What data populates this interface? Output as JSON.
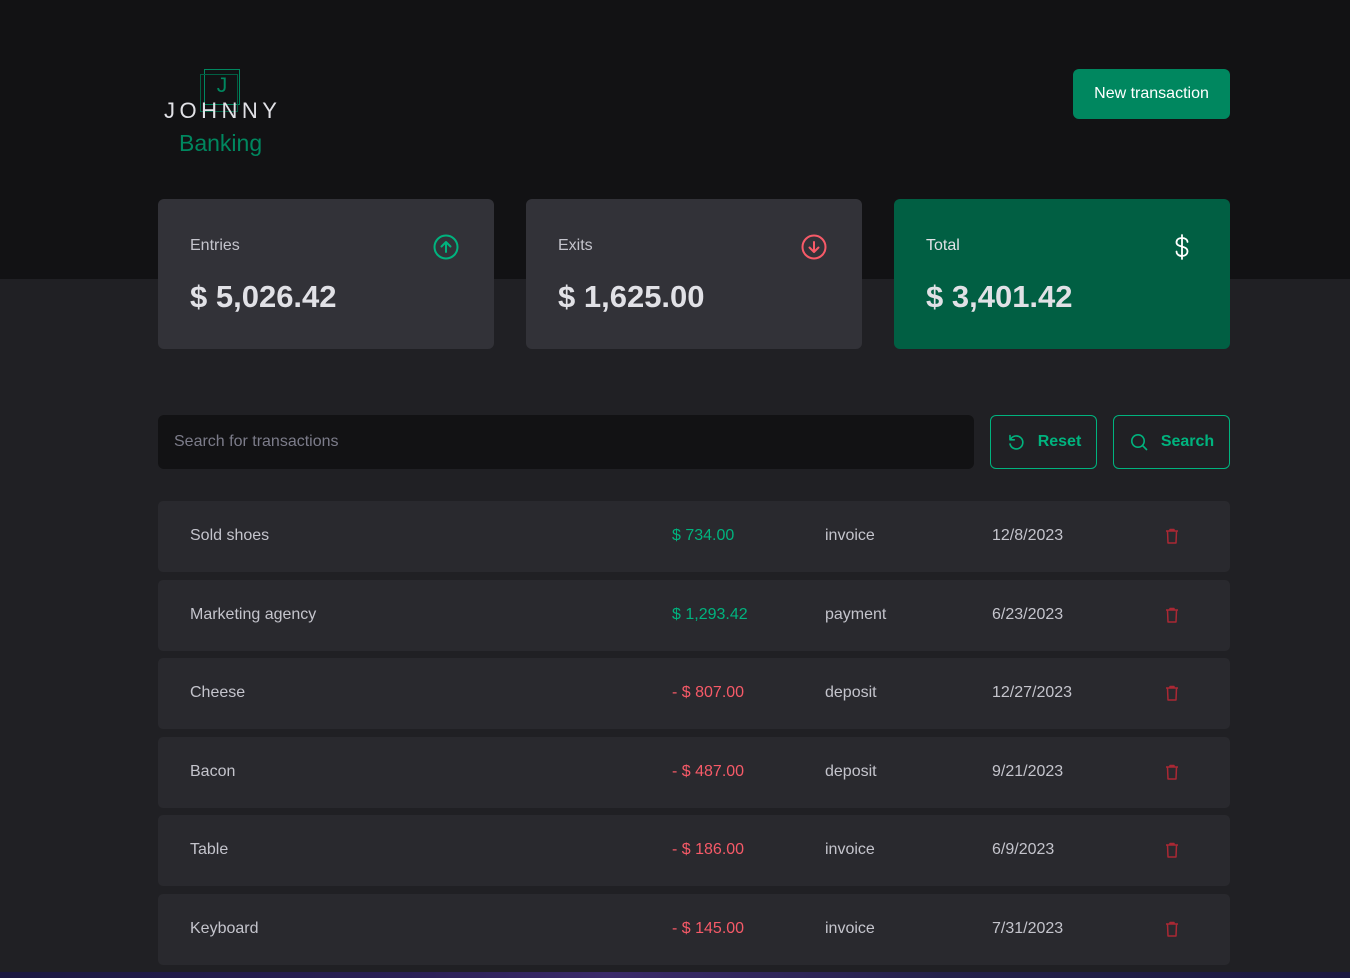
{
  "brand": {
    "letter": "J",
    "name": "JOHNNY",
    "sub": "Banking"
  },
  "header": {
    "new_transaction_label": "New transaction"
  },
  "summary": {
    "entries": {
      "label": "Entries",
      "value": "$ 5,026.42",
      "icon": "arrow-circle-up-icon",
      "color": "#00b37e"
    },
    "exits": {
      "label": "Exits",
      "value": "$ 1,625.00",
      "icon": "arrow-circle-down-icon",
      "color": "#f75a68"
    },
    "total": {
      "label": "Total",
      "value": "$ 3,401.42",
      "icon": "currency-dollar-icon",
      "color": "#015f43"
    }
  },
  "search": {
    "placeholder": "Search for transactions",
    "value": "",
    "reset_label": "Reset",
    "search_label": "Search"
  },
  "transactions": [
    {
      "description": "Sold shoes",
      "price": "$ 734.00",
      "type": "income",
      "category": "invoice",
      "date": "12/8/2023"
    },
    {
      "description": "Marketing agency",
      "price": "$ 1,293.42",
      "type": "income",
      "category": "payment",
      "date": "6/23/2023"
    },
    {
      "description": "Cheese",
      "price": "- $ 807.00",
      "type": "outcome",
      "category": "deposit",
      "date": "12/27/2023"
    },
    {
      "description": "Bacon",
      "price": "- $ 487.00",
      "type": "outcome",
      "category": "deposit",
      "date": "9/21/2023"
    },
    {
      "description": "Table",
      "price": "- $ 186.00",
      "type": "outcome",
      "category": "invoice",
      "date": "6/9/2023"
    },
    {
      "description": "Keyboard",
      "price": "- $ 145.00",
      "type": "outcome",
      "category": "invoice",
      "date": "7/31/2023"
    }
  ],
  "colors": {
    "income": "#00b37e",
    "outcome": "#f75a68",
    "brand": "#00875f"
  }
}
